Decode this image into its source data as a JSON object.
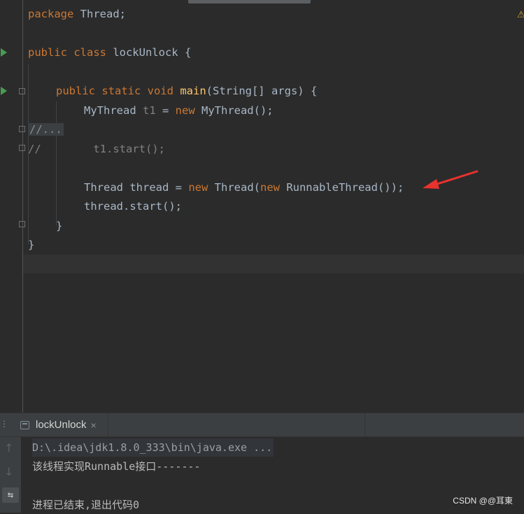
{
  "editor": {
    "line1": {
      "kw": "package",
      "rest": " Thread;"
    },
    "line3": {
      "kw": "public class",
      "name": " lockUnlock {"
    },
    "line5": {
      "kw": "public static void",
      "fn": "main",
      "rest": "(String[] args) {"
    },
    "line6": {
      "type": "MyThread",
      "var": " t1",
      "eq": " = ",
      "kw": "new",
      "rest": " MyThread();"
    },
    "line7": {
      "fold": "//..."
    },
    "line8": {
      "comment": "//        t1.start();"
    },
    "line10": {
      "type": "Thread",
      "var": " thread",
      "eq": " = ",
      "kw1": "new",
      "mid": " Thread(",
      "kw2": "new",
      "rest": " RunnableThread());"
    },
    "line11": {
      "text": "thread.start();"
    },
    "line12": {
      "text": "}"
    },
    "line13": {
      "text": "}"
    },
    "warning_icon": "⚠",
    "annotation_color": "#e8322d"
  },
  "console": {
    "tab_label": "lockUnlock",
    "tab_close": "×",
    "lines": [
      "D:\\.idea\\jdk1.8.0_333\\bin\\java.exe ...",
      "该线程实现Runnable接口-------",
      "",
      "进程已结束,退出代码0"
    ],
    "up_arrow": "↑",
    "down_arrow": "↓",
    "wrap_icon": "⇆"
  },
  "watermark": "CSDN @@耳東"
}
